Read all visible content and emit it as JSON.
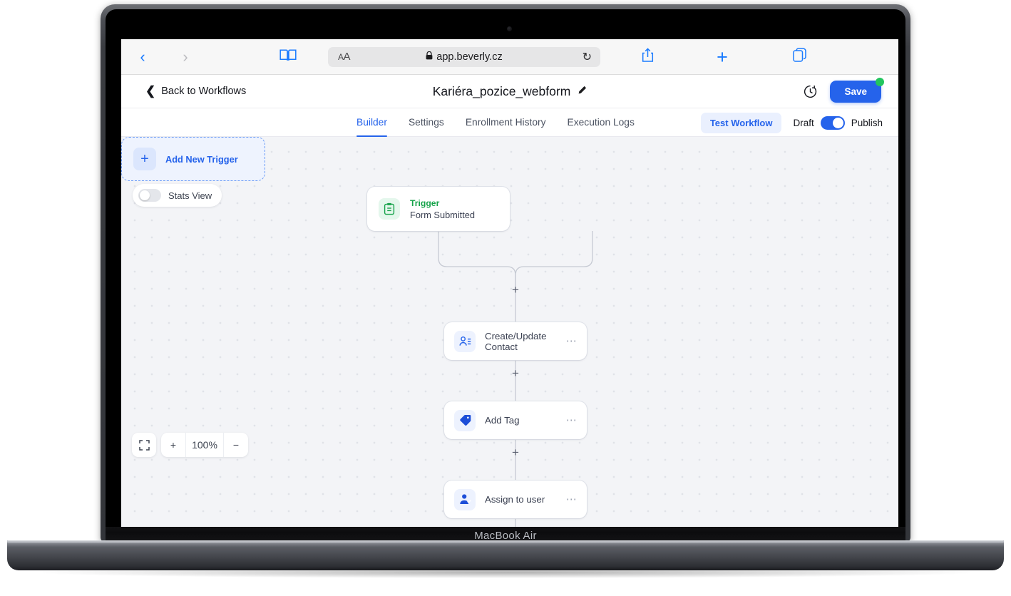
{
  "device": {
    "model_label": "MacBook Air"
  },
  "browser": {
    "back_icon": "chevron-left-icon",
    "forward_icon": "chevron-right-icon",
    "bookmarks_icon": "book-icon",
    "text_size_label": "AA",
    "lock_icon": "lock-icon",
    "url": "app.beverly.cz",
    "reload_icon": "reload-icon",
    "share_icon": "share-icon",
    "new_tab_icon": "plus-icon",
    "tabs_icon": "tabs-icon"
  },
  "app_header": {
    "back_label": "Back to Workflows",
    "title": "Kariéra_pozice_webform",
    "edit_icon": "pencil-icon",
    "history_icon": "history-clock-icon",
    "save_label": "Save",
    "save_badge": "unsaved-changes-dot"
  },
  "tabs": {
    "items": [
      {
        "label": "Builder",
        "active": true
      },
      {
        "label": "Settings",
        "active": false
      },
      {
        "label": "Enrollment History",
        "active": false
      },
      {
        "label": "Execution Logs",
        "active": false
      }
    ],
    "test_workflow_label": "Test Workflow",
    "draft_label": "Draft",
    "publish_label": "Publish",
    "publish_toggle_on": true
  },
  "canvas": {
    "stats_view_label": "Stats View",
    "stats_view_on": false,
    "trigger": {
      "kicker": "Trigger",
      "title": "Form Submitted",
      "icon": "clipboard-icon"
    },
    "add_trigger": {
      "label": "Add New Trigger",
      "icon": "plus-icon"
    },
    "nodes": [
      {
        "label": "Create/Update Contact",
        "icon": "contact-card-icon",
        "menu_icon": "more-dots-icon"
      },
      {
        "label": "Add Tag",
        "icon": "tag-icon",
        "menu_icon": "more-dots-icon"
      },
      {
        "label": "Assign to user",
        "icon": "assign-user-icon",
        "menu_icon": "more-dots-icon"
      }
    ],
    "add_step_icon": "plus-icon",
    "zoom": {
      "fit_icon": "fit-screen-icon",
      "zoom_in_icon": "plus-icon",
      "level": "100%",
      "zoom_out_icon": "minus-icon"
    },
    "minimap_name": "canvas-minimap"
  },
  "colors": {
    "accent": "#2563eb",
    "trigger_green": "#16a34a",
    "badge_green": "#22c55e",
    "canvas_bg": "#f3f4f7"
  }
}
